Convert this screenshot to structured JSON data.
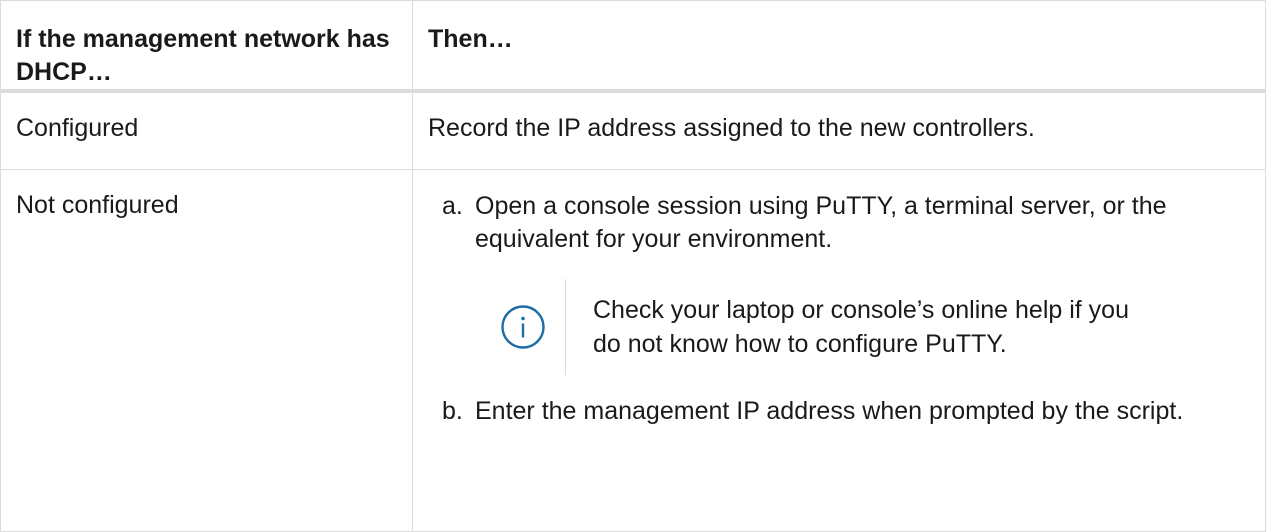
{
  "table": {
    "headers": [
      "If the management network has DHCP…",
      "Then…"
    ],
    "rows": [
      {
        "condition": "Configured",
        "action": "Record the IP address assigned to the new controllers."
      },
      {
        "condition": "Not configured",
        "steps": [
          {
            "marker": "a.",
            "text": "Open a console session using PuTTY, a terminal server, or the equivalent for your environment."
          },
          {
            "marker": "b.",
            "text": "Enter the management IP address when prompted by the script."
          }
        ],
        "note": {
          "icon": "info-icon",
          "text": "Check your laptop or console’s online help if you do not know how to configure PuTTY."
        }
      }
    ]
  },
  "colors": {
    "border": "#dcdcdc",
    "icon": "#1c6ca8",
    "text": "#1a1a1a"
  }
}
